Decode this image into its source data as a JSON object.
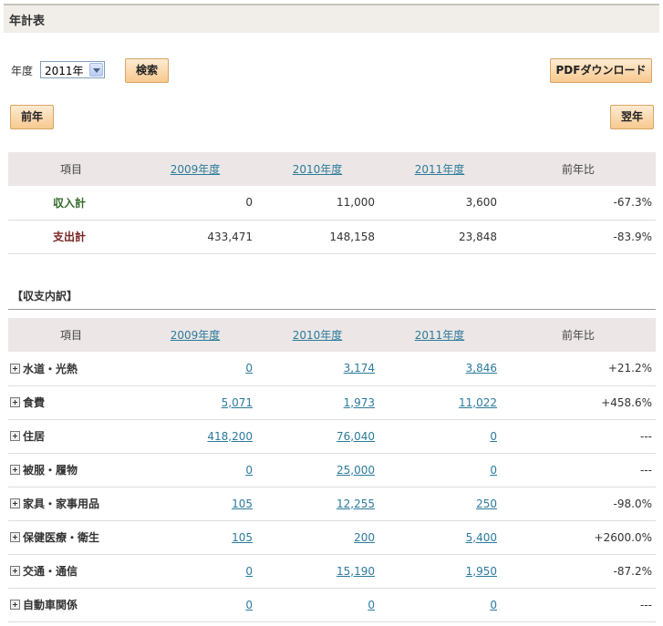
{
  "page_title": "年計表",
  "filter": {
    "year_label": "年度",
    "year_value": "2011年",
    "search_label": "検索",
    "pdf_label": "PDFダウンロード"
  },
  "nav": {
    "prev_label": "前年",
    "next_label": "翌年"
  },
  "summary": {
    "headers": [
      "項目",
      "2009年度",
      "2010年度",
      "2011年度",
      "前年比"
    ],
    "rows": [
      {
        "label": "収入計",
        "v2009": "0",
        "v2010": "11,000",
        "v2011": "3,600",
        "rate": "-67.3%"
      },
      {
        "label": "支出計",
        "v2009": "433,471",
        "v2010": "148,158",
        "v2011": "23,848",
        "rate": "-83.9%"
      }
    ]
  },
  "breakdown": {
    "title": "【収支内訳】",
    "headers": [
      "項目",
      "2009年度",
      "2010年度",
      "2011年度",
      "前年比"
    ],
    "rows": [
      {
        "label": "水道・光熱",
        "v2009": "0",
        "v2010": "3,174",
        "v2011": "3,846",
        "rate": "+21.2%"
      },
      {
        "label": "食費",
        "v2009": "5,071",
        "v2010": "1,973",
        "v2011": "11,022",
        "rate": "+458.6%"
      },
      {
        "label": "住居",
        "v2009": "418,200",
        "v2010": "76,040",
        "v2011": "0",
        "rate": "---"
      },
      {
        "label": "被服・履物",
        "v2009": "0",
        "v2010": "25,000",
        "v2011": "0",
        "rate": "---"
      },
      {
        "label": "家具・家事用品",
        "v2009": "105",
        "v2010": "12,255",
        "v2011": "250",
        "rate": "-98.0%"
      },
      {
        "label": "保健医療・衛生",
        "v2009": "105",
        "v2010": "200",
        "v2011": "5,400",
        "rate": "+2600.0%"
      },
      {
        "label": "交通・通信",
        "v2009": "0",
        "v2010": "15,190",
        "v2011": "1,950",
        "rate": "-87.2%"
      },
      {
        "label": "自動車関係",
        "v2009": "0",
        "v2010": "0",
        "v2011": "0",
        "rate": "---"
      }
    ]
  }
}
